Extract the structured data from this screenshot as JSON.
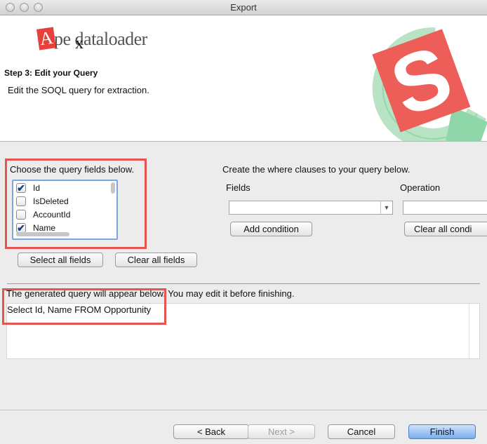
{
  "window": {
    "title": "Export"
  },
  "header": {
    "logo_a": "A",
    "logo_rest": "pe dataloader",
    "logo_x": "x",
    "step_title": "Step 3: Edit your Query",
    "step_description": "Edit the SOQL query for extraction."
  },
  "fields_panel": {
    "label": "Choose the query fields below.",
    "items": [
      {
        "label": "Id",
        "checked": true
      },
      {
        "label": "IsDeleted",
        "checked": false
      },
      {
        "label": "AccountId",
        "checked": false
      },
      {
        "label": "Name",
        "checked": true
      }
    ],
    "select_all_label": "Select all fields",
    "clear_all_label": "Clear all fields"
  },
  "where_panel": {
    "label": "Create the where clauses to your query below.",
    "fields_label": "Fields",
    "operation_label": "Operation",
    "add_condition_label": "Add condition",
    "clear_all_conditions_label": "Clear all condi"
  },
  "query_panel": {
    "label": "The generated query will appear below.  You may edit it before finishing.",
    "query_text": "Select Id, Name FROM Opportunity"
  },
  "footer": {
    "back_label": "< Back",
    "next_label": "Next >",
    "cancel_label": "Cancel",
    "finish_label": "Finish"
  },
  "colors": {
    "highlight": "#e5554f",
    "finish_button": "#79aef0",
    "soql_logo_red": "#ee5e59",
    "soql_logo_green": "#7fcf9a"
  }
}
